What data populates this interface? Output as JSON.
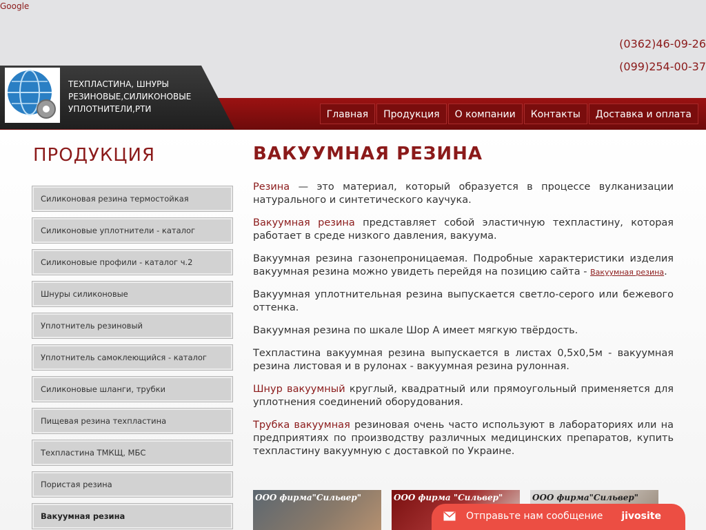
{
  "top": {
    "google_link": "Google",
    "phone1": "(0362)46-09-26",
    "phone2": "(099)254-00-37"
  },
  "brand": {
    "text": "ТЕХПЛАСТИНА, ШНУРЫ РЕЗИНОВЫЕ,СИЛИКОНОВЫЕ УПЛОТНИТЕЛИ,РТИ"
  },
  "nav": {
    "items": [
      "Главная",
      "Продукция",
      "О компании",
      "Контакты",
      "Доставка и оплата"
    ]
  },
  "sidebar": {
    "title": "ПРОДУКЦИЯ",
    "items": [
      "Силиконовая резина термостойкая",
      "Силиконовые уплотнители - каталог",
      "Силиконовые профили - каталог ч.2",
      "Шнуры силиконовые",
      "Уплотнитель резиновый",
      "Уплотнитель самоклеющийся - каталог",
      "Силиконовые шланги, трубки",
      "Пищевая резина техпластина",
      "Техпластина ТМКЩ, МБС",
      "Пористая резина",
      "Вакуумная резина"
    ]
  },
  "main": {
    "title": "ВАКУУМНАЯ РЕЗИНА",
    "p1_hl": "Резина",
    "p1": " — это материал, который образуется в процессе вулканизации натурального и синтетического каучука.",
    "p2_hl": "Вакуумная резина",
    "p2": " представляет собой эластичную техпластину, которая работает в среде низкого давления, вакуума.",
    "p3": "Вакуумная резина газонепроницаемая. Подробные характеристики изделия вакуумная резина можно увидеть перейдя на позицию сайта - ",
    "p3_link": "Вакуумная резина",
    "p3_end": ".",
    "p4": "Вакуумная уплотнительная резина выпускается светло-серого или бежевого оттенка.",
    "p5": "Вакуумная резина по шкале Шор А имеет мягкую твёрдость.",
    "p6": "Техпластина вакуумная резина выпускается в листах 0,5х0,5м - вакуумная резина листовая и в рулонах - вакуумная резина рулонная.",
    "p7_hl": "Шнур вакуумный",
    "p7": " круглый, квадратный или прямоугольный применяется для уплотнения соединений оборудования.",
    "p8_hl": "Трубка вакуумная",
    "p8": " резиновая очень часто используют в лабораториях или на предприятиях по производству различных медицинских препаратов, купить техпластину вакуумную с доставкой по Украине."
  },
  "thumbs": {
    "cap1": "ООО фирма\"Сильвер\"",
    "cap2": "ООО фирма \"Сильвер\"",
    "cap3": "ООО фирма\"Сильвер\""
  },
  "chat": {
    "text": "Отправьте нам сообщение",
    "brand": "jivosite"
  },
  "colors": {
    "accent": "#8b1a1a",
    "menu_red": "#7a0d0d",
    "chat": "#ec4e43"
  }
}
